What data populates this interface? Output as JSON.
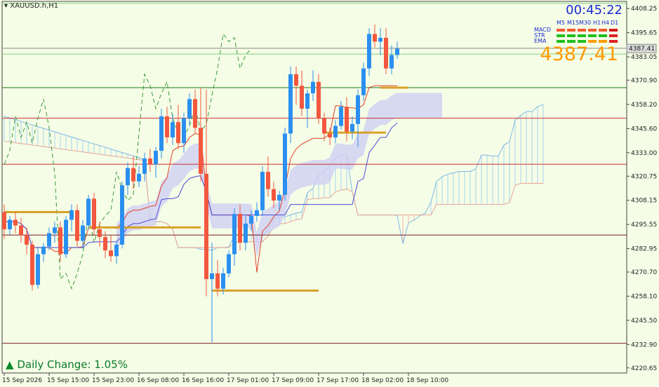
{
  "header": {
    "symbol": "XAUUSD.h,H1",
    "timer": "00:45:22",
    "price_display": "4387.41",
    "daily_change_label": "Daily Change: 1.05%"
  },
  "colors": {
    "background": "#f5fde6",
    "bull": "#2b8ff0",
    "bear": "#f4573f",
    "cloud_bull": "#a8d4ee",
    "cloud_bear": "#f0b3a6",
    "kumo_fill": "#cfd0f4",
    "green_line": "#7fd17f",
    "red_line": "#c83232",
    "gold_line": "#d9a12a",
    "price_orange": "#ff9b00",
    "timer_blue": "#1a2bd0"
  },
  "indicator_panel": {
    "timeframes": [
      "M5",
      "M15",
      "M30",
      "H1",
      "H4",
      "D1"
    ],
    "rows": [
      {
        "name": "MACD",
        "cells": [
          "#f4572e",
          "#f4572e",
          "#f4572e",
          "#f4572e",
          "#f4572e",
          "#d41818"
        ]
      },
      {
        "name": "STR",
        "cells": [
          "#1fbf1f",
          "#1fbf1f",
          "#1fbf1f",
          "#1fbf1f",
          "#1fbf1f",
          "#e02020"
        ]
      },
      {
        "name": "EMA",
        "cells": [
          "#1fbf1f",
          "#1fbf1f",
          "#1fbf1f",
          "#ff9b00",
          "#ff9b00",
          "#e02020"
        ]
      }
    ]
  },
  "chart_data": {
    "type": "candlestick",
    "ylim": [
      4218,
      4412
    ],
    "y_ticks": [
      4408.25,
      4395.65,
      4383.05,
      4370.9,
      4358.2,
      4345.6,
      4333.0,
      4320.75,
      4308.15,
      4295.55,
      4282.95,
      4270.7,
      4258.1,
      4245.5,
      4232.9,
      4220.65
    ],
    "current_price_label": "4387.41",
    "x_tick_labels": [
      "15 Sep 2026",
      "15 Sep 15:00",
      "15 Sep 23:00",
      "16 Sep 08:00",
      "16 Sep 16:00",
      "17 Sep 01:00",
      "17 Sep 09:00",
      "17 Sep 17:00",
      "18 Sep 02:00",
      "18 Sep 10:00"
    ],
    "x_tick_candle_index": [
      0,
      8,
      16,
      24,
      32,
      40,
      48,
      56,
      64,
      72
    ],
    "candles": [
      [
        4302,
        4306,
        4288,
        4293
      ],
      [
        4293,
        4300,
        4290,
        4298
      ],
      [
        4298,
        4302,
        4291,
        4295
      ],
      [
        4295,
        4299,
        4286,
        4290
      ],
      [
        4290,
        4294,
        4280,
        4285
      ],
      [
        4285,
        4287,
        4261,
        4264
      ],
      [
        4264,
        4284,
        4262,
        4280
      ],
      [
        4280,
        4286,
        4276,
        4284
      ],
      [
        4284,
        4294,
        4282,
        4291
      ],
      [
        4291,
        4297,
        4286,
        4294
      ],
      [
        4294,
        4297,
        4276,
        4280
      ],
      [
        4280,
        4300,
        4278,
        4298
      ],
      [
        4298,
        4306,
        4292,
        4303
      ],
      [
        4303,
        4306,
        4284,
        4287
      ],
      [
        4287,
        4298,
        4283,
        4295
      ],
      [
        4295,
        4311,
        4293,
        4309
      ],
      [
        4309,
        4312,
        4290,
        4293
      ],
      [
        4293,
        4297,
        4284,
        4289
      ],
      [
        4289,
        4292,
        4278,
        4282
      ],
      [
        4282,
        4290,
        4276,
        4279
      ],
      [
        4279,
        4287,
        4275,
        4285
      ],
      [
        4285,
        4318,
        4283,
        4316
      ],
      [
        4316,
        4328,
        4311,
        4325
      ],
      [
        4325,
        4331,
        4314,
        4318
      ],
      [
        4318,
        4326,
        4315,
        4322
      ],
      [
        4322,
        4333,
        4318,
        4330
      ],
      [
        4330,
        4335,
        4323,
        4327
      ],
      [
        4327,
        4336,
        4320,
        4334
      ],
      [
        4334,
        4356,
        4330,
        4352
      ],
      [
        4352,
        4357,
        4338,
        4341
      ],
      [
        4341,
        4353,
        4337,
        4349
      ],
      [
        4349,
        4358,
        4335,
        4338
      ],
      [
        4338,
        4354,
        4333,
        4351
      ],
      [
        4351,
        4364,
        4347,
        4361
      ],
      [
        4361,
        4366,
        4343,
        4346
      ],
      [
        4346,
        4367,
        4318,
        4322
      ],
      [
        4322,
        4366,
        4258,
        4267
      ],
      [
        4267,
        4286,
        4234,
        4270
      ],
      [
        4270,
        4277,
        4258,
        4262
      ],
      [
        4262,
        4273,
        4259,
        4270
      ],
      [
        4270,
        4282,
        4268,
        4280
      ],
      [
        4280,
        4304,
        4274,
        4301
      ],
      [
        4301,
        4306,
        4282,
        4286
      ],
      [
        4286,
        4300,
        4282,
        4296
      ],
      [
        4296,
        4303,
        4292,
        4300
      ],
      [
        4300,
        4307,
        4297,
        4303
      ],
      [
        4303,
        4326,
        4300,
        4323
      ],
      [
        4323,
        4331,
        4310,
        4314
      ],
      [
        4314,
        4318,
        4304,
        4308
      ],
      [
        4308,
        4313,
        4303,
        4311
      ],
      [
        4311,
        4346,
        4308,
        4343
      ],
      [
        4343,
        4378,
        4338,
        4374
      ],
      [
        4374,
        4378,
        4358,
        4368
      ],
      [
        4368,
        4376,
        4352,
        4356
      ],
      [
        4356,
        4366,
        4346,
        4364
      ],
      [
        4364,
        4376,
        4360,
        4370
      ],
      [
        4370,
        4374,
        4348,
        4351
      ],
      [
        4351,
        4354,
        4339,
        4343
      ],
      [
        4343,
        4346,
        4337,
        4341
      ],
      [
        4341,
        4350,
        4338,
        4347
      ],
      [
        4347,
        4360,
        4345,
        4357
      ],
      [
        4357,
        4362,
        4339,
        4344
      ],
      [
        4344,
        4352,
        4340,
        4348
      ],
      [
        4348,
        4366,
        4336,
        4363
      ],
      [
        4363,
        4380,
        4360,
        4377
      ],
      [
        4377,
        4398,
        4373,
        4395
      ],
      [
        4395,
        4400,
        4388,
        4391
      ],
      [
        4391,
        4398,
        4384,
        4393
      ],
      [
        4393,
        4398,
        4374,
        4377
      ],
      [
        4377,
        4389,
        4374,
        4384
      ],
      [
        4384,
        4391,
        4382,
        4387.4
      ]
    ],
    "horizontal_lines": [
      {
        "price": 4411.0,
        "color": "#7fd17f"
      },
      {
        "price": 4387.5,
        "color": "#8a8a8a"
      },
      {
        "price": 4384.5,
        "color": "#7fd17f"
      },
      {
        "price": 4367.0,
        "color": "#1f7a1f"
      },
      {
        "price": 4351.0,
        "color": "#c83232"
      },
      {
        "price": 4327.0,
        "color": "#c83232"
      },
      {
        "price": 4290.0,
        "color": "#7a2020"
      },
      {
        "price": 4233.5,
        "color": "#7a2020"
      }
    ],
    "gold_segments": [
      {
        "from": 0,
        "to": 12,
        "price": 4302
      },
      {
        "from": 15,
        "to": 35,
        "price": 4294
      },
      {
        "from": 37,
        "to": 56,
        "price": 4261
      },
      {
        "from": 57,
        "to": 68,
        "price": 4343.5
      },
      {
        "from": 67,
        "to": 72,
        "price": 4367
      }
    ]
  }
}
